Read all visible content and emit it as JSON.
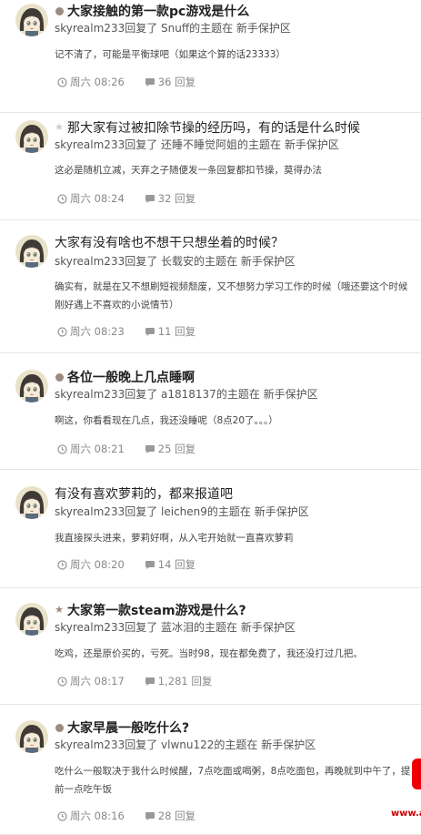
{
  "threads": [
    {
      "icon": "dot",
      "title": "大家接触的第一款pc游戏是什么",
      "title_bold": true,
      "reply": "skyrealm233回复了 Snuff的主题在 新手保护区",
      "excerpt": "记不清了，可能是平衡球吧（如果这个算的话23333）",
      "time": "周六 08:26",
      "replies": "36 回复"
    },
    {
      "icon": "star-outline",
      "title": "那大家有过被扣除节操的经历吗，有的话是什么时候",
      "title_bold": false,
      "reply": "skyrealm233回复了 还睡不睡觉阿姐的主题在 新手保护区",
      "excerpt": "这必是随机立减，天弃之子随便发一条回复都扣节操，莫得办法",
      "time": "周六 08:24",
      "replies": "32 回复"
    },
    {
      "icon": "none",
      "title": "大家有没有啥也不想干只想坐着的时候？",
      "title_bold": false,
      "reply": "skyrealm233回复了 长载安的主题在 新手保护区",
      "excerpt": "确实有，就是在又不想刷短视频颓废，又不想努力学习工作的时候（哦还要这个时候刚好遇上不喜欢的小说情节）",
      "time": "周六 08:23",
      "replies": "11 回复"
    },
    {
      "icon": "dot",
      "title": "各位一般晚上几点睡啊",
      "title_bold": true,
      "reply": "skyrealm233回复了 a1818137的主题在 新手保护区",
      "excerpt": "啊这，你看看现在几点，我还没睡呢（8点20了。。。）",
      "time": "周六 08:21",
      "replies": "25 回复"
    },
    {
      "icon": "none",
      "title": "有没有喜欢萝莉的，都来报道吧",
      "title_bold": false,
      "reply": "skyrealm233回复了 leichen9的主题在 新手保护区",
      "excerpt": "我直接探头进来，萝莉好啊，从入宅开始就一直喜欢萝莉",
      "time": "周六 08:20",
      "replies": "14 回复"
    },
    {
      "icon": "star-filled",
      "title": "大家第一款steam游戏是什么?",
      "title_bold": true,
      "reply": "skyrealm233回复了 蓝冰泪的主题在 新手保护区",
      "excerpt": "吃鸡，还是原价买的，亏死。当时98，现在都免费了，我还没打过几把。",
      "time": "周六 08:17",
      "replies": "1,281 回复"
    },
    {
      "icon": "dot",
      "title": "大家早晨一般吃什么?",
      "title_bold": true,
      "reply": "skyrealm233回复了 vlwnu122的主题在 新手保护区",
      "excerpt": "吃什么一般取决于我什么时候醒，7点吃面或喝粥，8点吃面包，再晚就到中午了，提前一点吃午饭",
      "time": "周六 08:16",
      "replies": "28 回复"
    }
  ],
  "watermark": "www.a 中 ●"
}
